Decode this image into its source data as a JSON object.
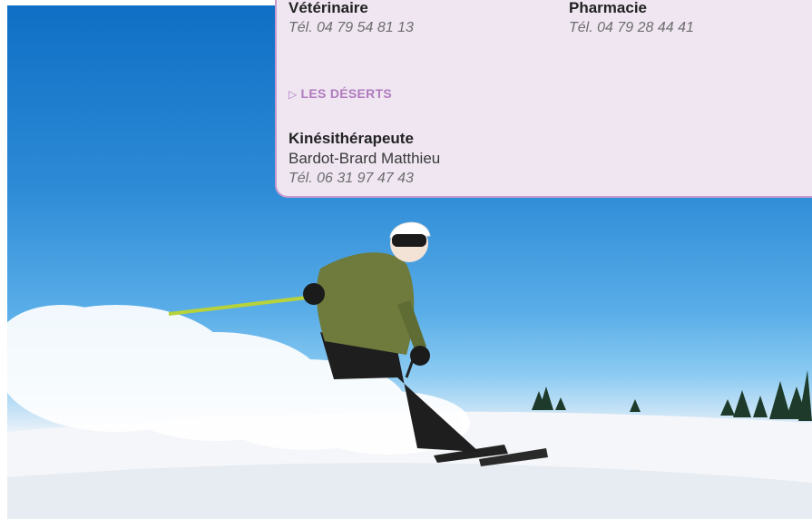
{
  "info_card": {
    "top_entries": [
      {
        "role": "Vétérinaire",
        "phone": "Tél. 04 79 54 81 13"
      },
      {
        "role": "Pharmacie",
        "phone": "Tél. 04 79 28 44 41"
      }
    ],
    "section": {
      "title": "LES DÉSERTS",
      "entry": {
        "role": "Kinésithérapeute",
        "person": "Bardot-Brard Matthieu",
        "phone": "Tél. 06 31 97 47 43"
      }
    }
  },
  "colors": {
    "card_background": "#efe6f2",
    "card_border": "#c89ad0",
    "section_accent": "#b07bbd"
  }
}
